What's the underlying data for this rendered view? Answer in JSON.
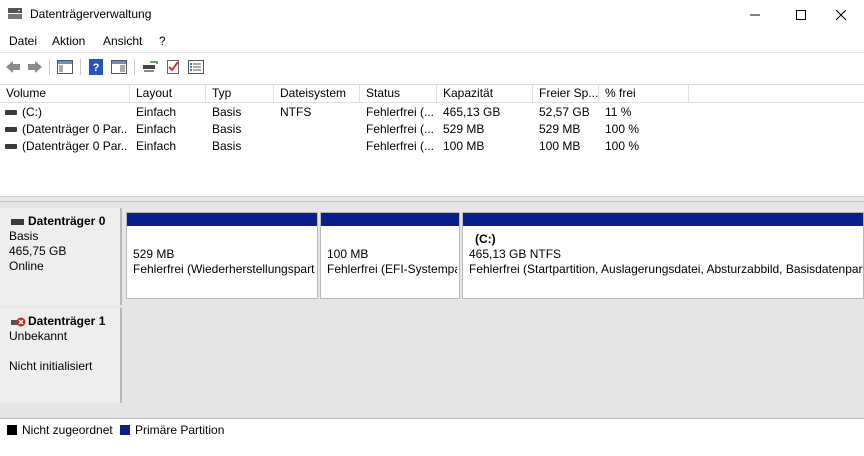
{
  "window": {
    "title": "Datenträgerverwaltung"
  },
  "menu": [
    "Datei",
    "Aktion",
    "Ansicht",
    "?"
  ],
  "table": {
    "columns": [
      "Volume",
      "Layout",
      "Typ",
      "Dateisystem",
      "Status",
      "Kapazität",
      "Freier Sp...",
      "% frei"
    ],
    "rows": [
      [
        "(C:)",
        "Einfach",
        "Basis",
        "NTFS",
        "Fehlerfrei (...",
        "465,13 GB",
        "52,57 GB",
        "11 %"
      ],
      [
        "(Datenträger 0 Par...",
        "Einfach",
        "Basis",
        "",
        "Fehlerfrei (...",
        "529 MB",
        "529 MB",
        "100 %"
      ],
      [
        "(Datenträger 0 Par...",
        "Einfach",
        "Basis",
        "",
        "Fehlerfrei (...",
        "100 MB",
        "100 MB",
        "100 %"
      ]
    ]
  },
  "disks": [
    {
      "name": "Datenträger 0",
      "type": "Basis",
      "size": "465,75 GB",
      "status": "Online",
      "partitions": [
        {
          "title": "",
          "size": "529 MB",
          "status": "Fehlerfrei (Wiederherstellungspart"
        },
        {
          "title": "",
          "size": "100 MB",
          "status": "Fehlerfrei (EFI-Systempa"
        },
        {
          "title": "(C:)",
          "size": "465,13 GB NTFS",
          "status": "Fehlerfrei (Startpartition, Auslagerungsdatei, Absturzabbild, Basisdatenpart"
        }
      ]
    },
    {
      "name": "Datenträger 1",
      "type": "Unbekannt",
      "status": "Nicht initialisiert"
    }
  ],
  "legend": [
    {
      "label": "Nicht zugeordnet",
      "color": "#000000"
    },
    {
      "label": "Primäre Partition",
      "color": "#0b1f8c"
    }
  ],
  "colors": {
    "partition_bar": "#0b1f8c"
  }
}
